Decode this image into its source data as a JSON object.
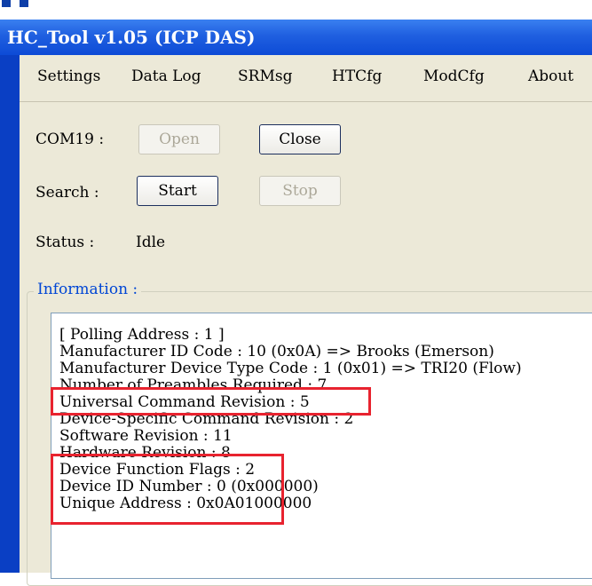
{
  "window": {
    "title": "HC_Tool v1.05  (ICP DAS)"
  },
  "menu": [
    {
      "label": "Settings"
    },
    {
      "label": "Data Log"
    },
    {
      "label": "SRMsg"
    },
    {
      "label": "HTCfg"
    },
    {
      "label": "ModCfg"
    },
    {
      "label": "About"
    }
  ],
  "com": {
    "label": "COM19 :",
    "open_label": "Open",
    "close_label": "Close"
  },
  "search": {
    "label": "Search :",
    "start_label": "Start",
    "stop_label": "Stop"
  },
  "status": {
    "label": "Status :",
    "value": "Idle"
  },
  "information": {
    "legend": "Information :",
    "lines": [
      "[ Polling Address : 1 ]",
      "Manufacturer ID Code : 10 (0x0A) => Brooks (Emerson)",
      "Manufacturer Device Type Code : 1 (0x01) => TRI20 (Flow)",
      "Number of Preambles Required : 7",
      "Universal Command Revision : 5",
      "Device-Specific Command Revision : 2",
      "Software Revision : 11",
      "Hardware Revision : 8",
      "Device Function Flags : 2",
      "Device ID Number : 0 (0x000000)",
      "Unique Address : 0x0A01000000"
    ]
  },
  "colors": {
    "titlebar": "#1f5fe0",
    "highlight": "#e8232f",
    "window_bg": "#ece9d8"
  }
}
